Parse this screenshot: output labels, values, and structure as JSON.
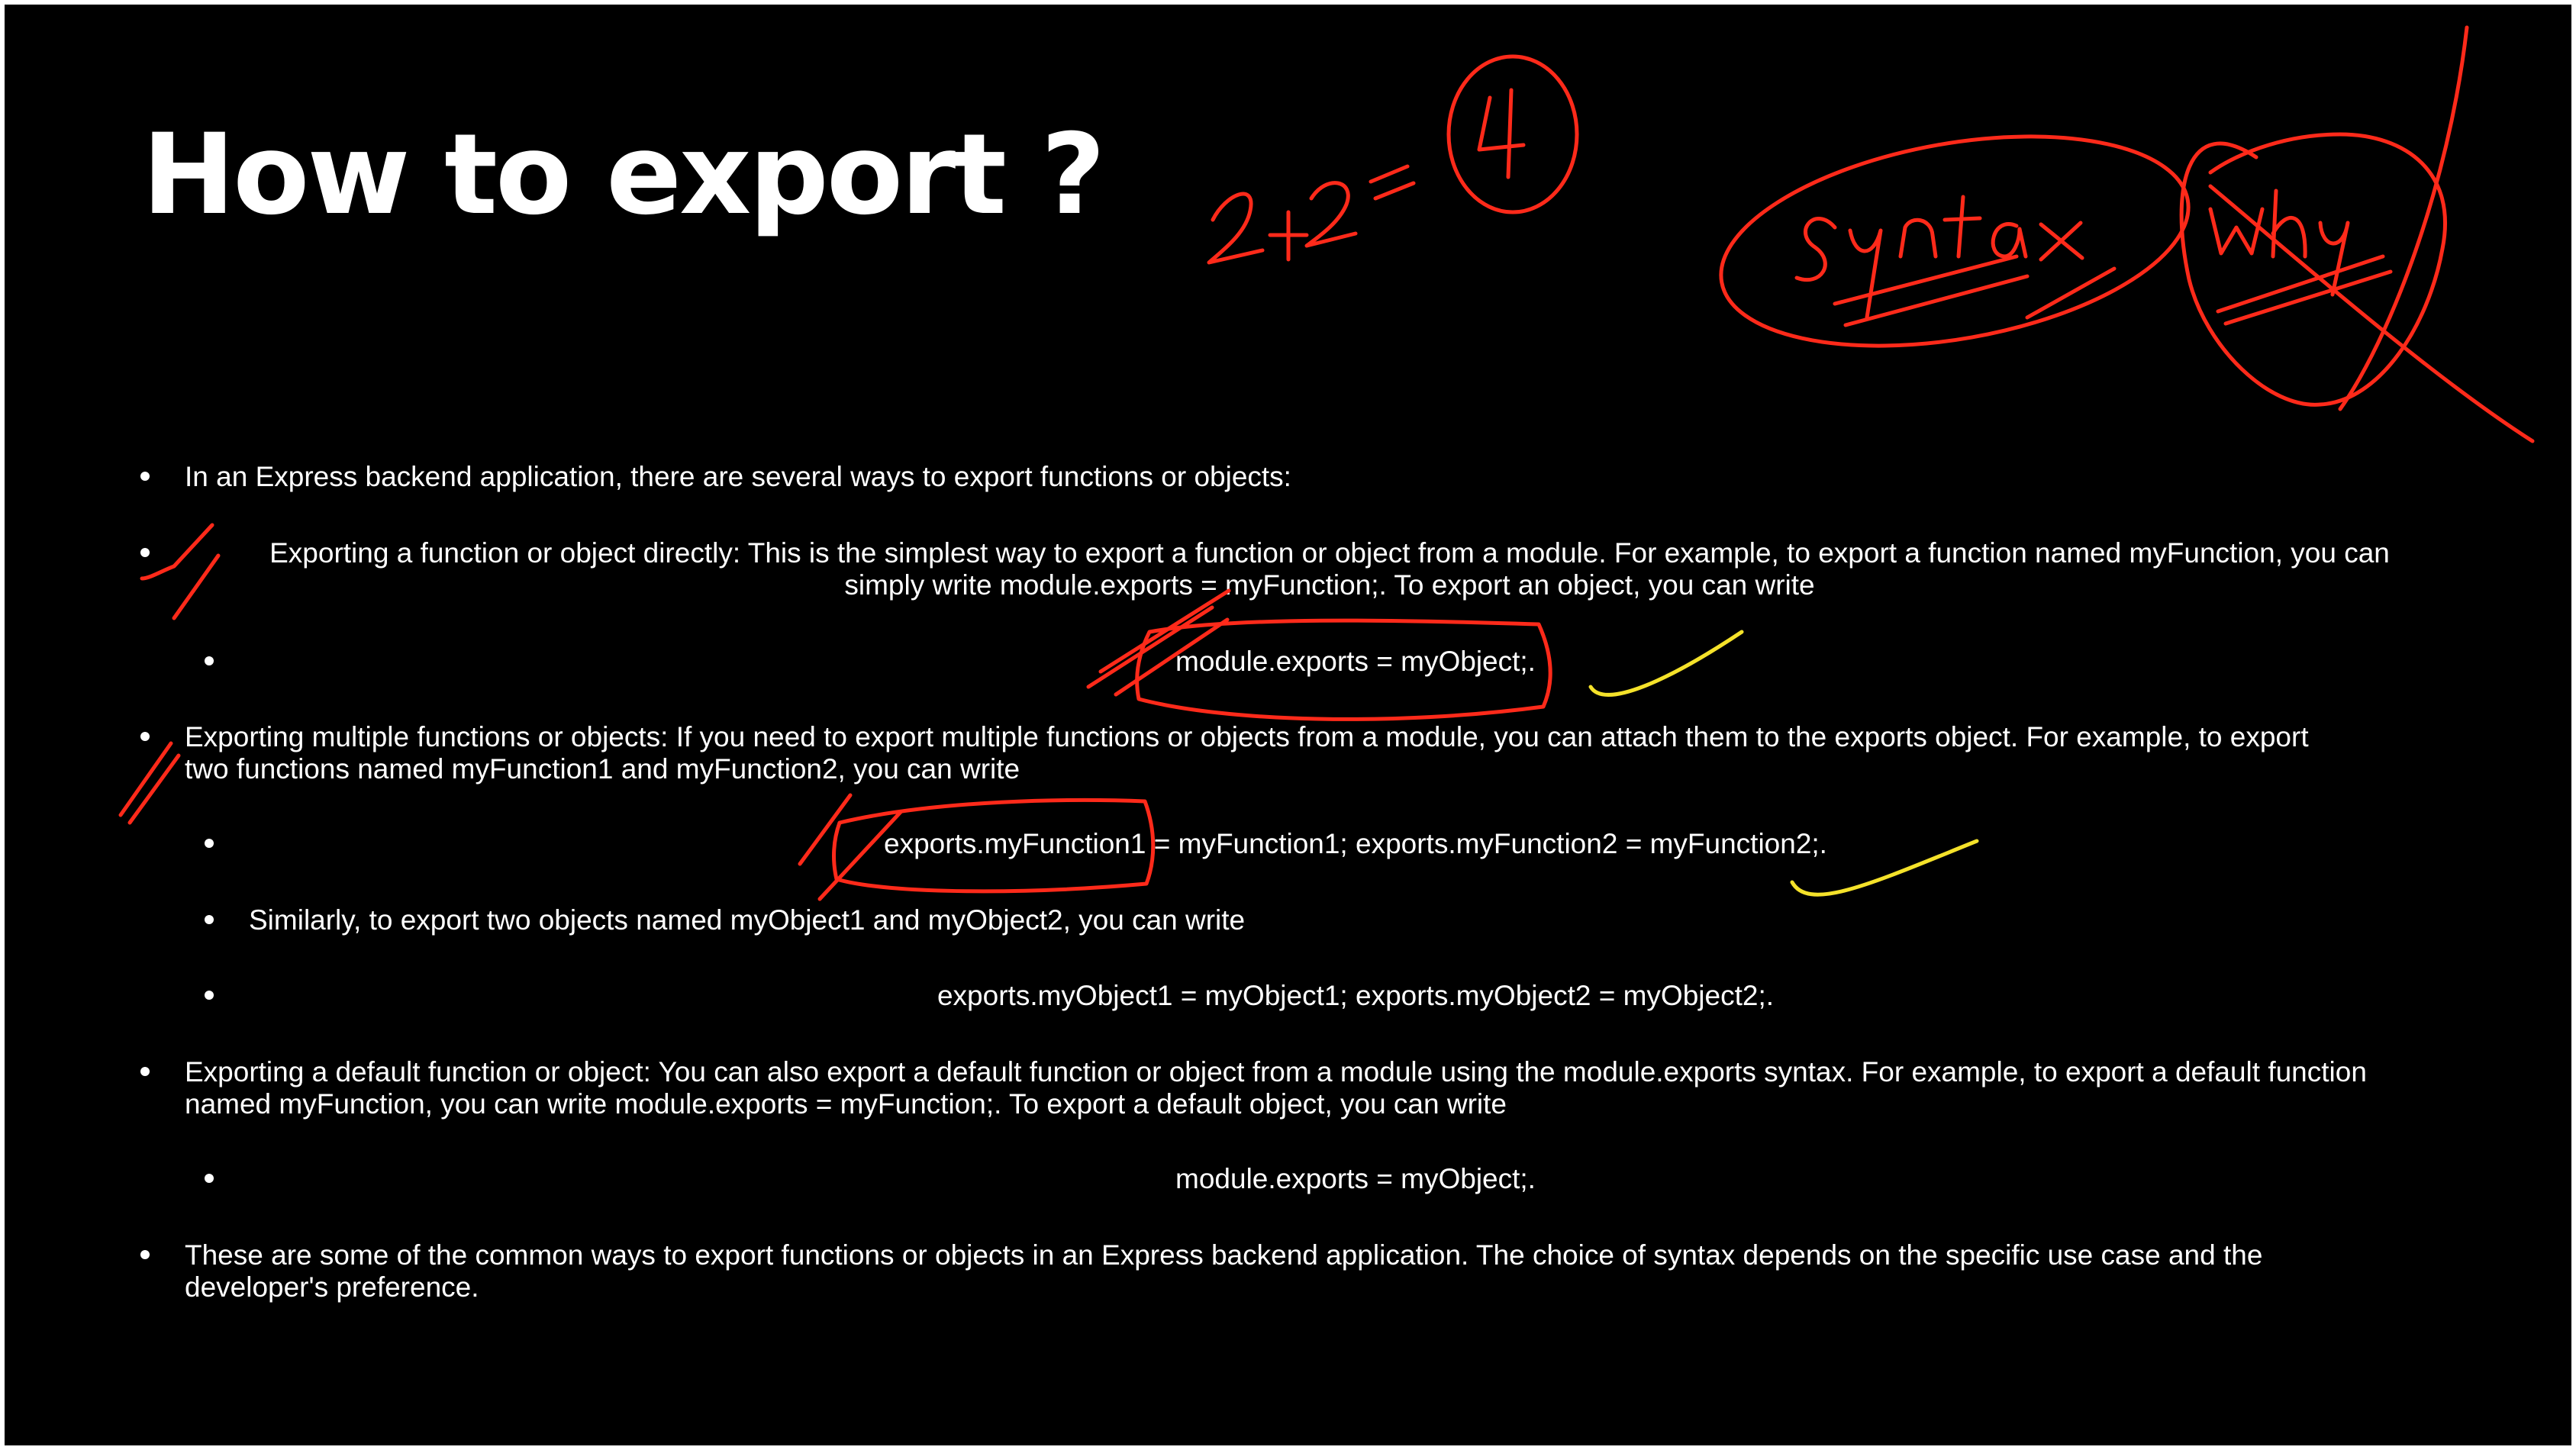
{
  "slide": {
    "title": "How to export ?",
    "bullets": {
      "b1": "In an Express backend application, there are several ways to export functions or objects:",
      "b2_line1": "Exporting a function or object directly: This is the simplest way to export a function or object from a module. For example, to export a function named myFunction, you can",
      "b2_line2": "simply write module.exports = myFunction;. To export an object, you can write",
      "b2_sub1": "module.exports = myObject;.",
      "b3_line1": "Exporting multiple functions or objects: If you need to export multiple functions or objects from a module, you can attach them to the exports object. For example, to export",
      "b3_line2": "two functions named myFunction1 and myFunction2, you can write",
      "b3_sub1": "exports.myFunction1 = myFunction1; exports.myFunction2 = myFunction2;.",
      "b3_sub2": "Similarly, to export two objects named myObject1 and myObject2, you can write",
      "b3_sub3": "exports.myObject1 = myObject1; exports.myObject2 = myObject2;.",
      "b4_line1": "Exporting a default function or object: You can also export a default function or object from a module using the module.exports syntax. For example, to export a default function",
      "b4_line2": "named myFunction, you can write module.exports = myFunction;. To export a default object, you can write",
      "b4_sub1": "module.exports = myObject;.",
      "b5_line1": "These are some of the common ways to export functions or objects in an Express backend application. The choice of syntax depends on the specific use case and the",
      "b5_line2": "developer's preference."
    }
  },
  "annotations": {
    "equation": "2+2=4",
    "syntax_word": "Syntax",
    "why_word": "why",
    "ink_color_red": "#ff2a1a",
    "ink_color_yellow": "#f5e22a"
  }
}
